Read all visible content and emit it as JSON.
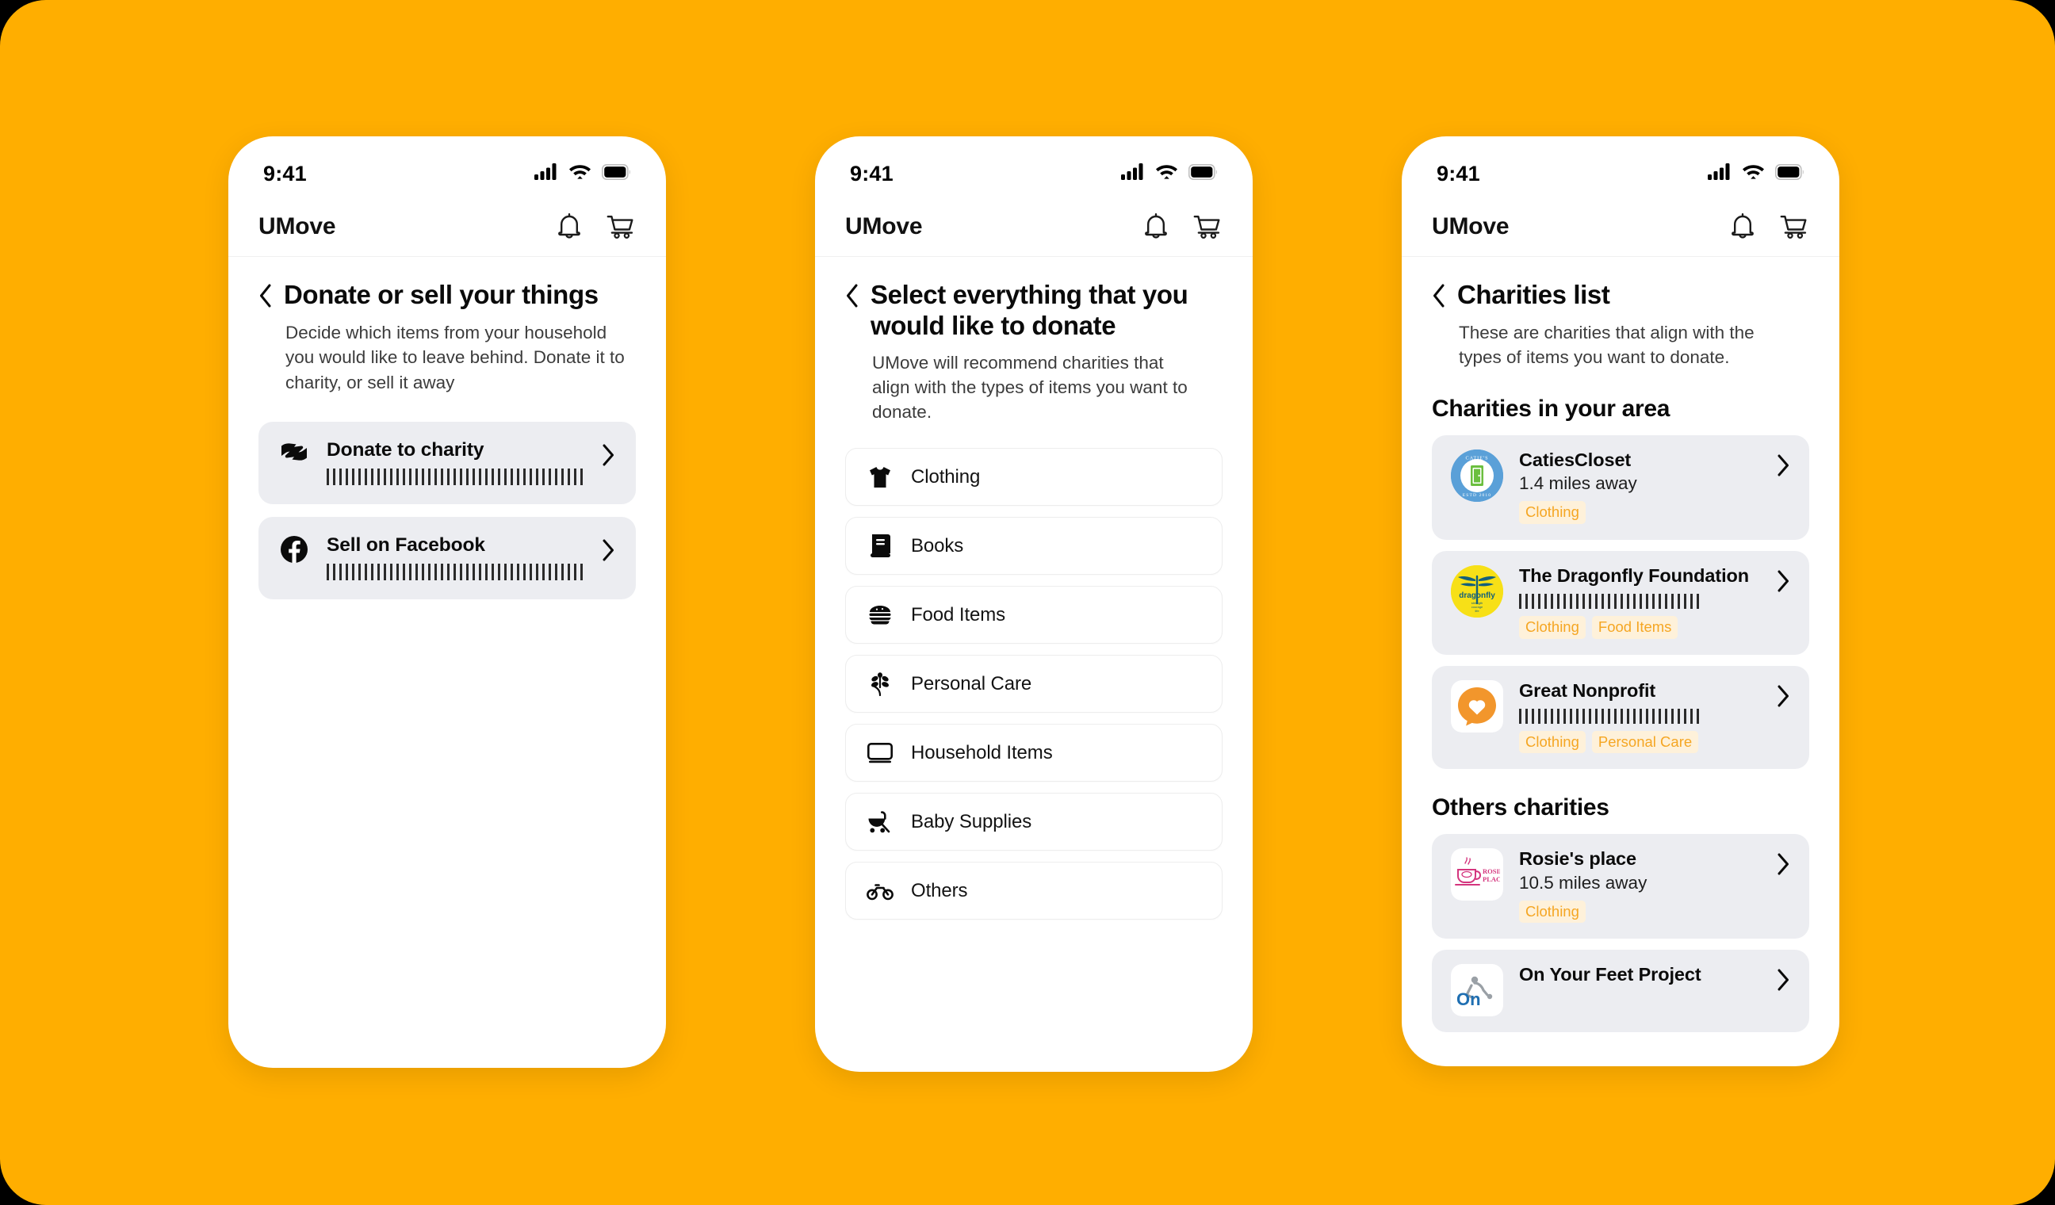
{
  "background": {
    "color": "#FFAE00"
  },
  "statusbar": {
    "time": "9:41",
    "signal_icon": "cellular-signal-icon",
    "wifi_icon": "wifi-icon",
    "battery_icon": "battery-icon"
  },
  "appbar": {
    "brand": "UMove",
    "bell_icon": "notification-bell-icon",
    "cart_icon": "shopping-cart-icon"
  },
  "accent": {
    "tag_text": "#F5A623",
    "tag_bg": "#FEF1DA",
    "card_bg": "#ECEDF1"
  },
  "screen1": {
    "back_icon": "back-chevron-icon",
    "title": "Donate or sell your things",
    "subtitle": "Decide which items from your household you would like to leave behind. Donate it to charity, or sell it away",
    "options": [
      {
        "label": "Donate to charity",
        "icon": "donation-hands-icon",
        "subtitle_redacted": true,
        "chevron_icon": "chevron-right-icon"
      },
      {
        "label": "Sell on Facebook",
        "icon": "facebook-icon",
        "subtitle_redacted": true,
        "chevron_icon": "chevron-right-icon"
      }
    ]
  },
  "screen2": {
    "back_icon": "back-chevron-icon",
    "title": "Select everything that you would like to donate",
    "subtitle": "UMove will recommend charities that align with the types of items you want to donate.",
    "categories": [
      {
        "label": "Clothing",
        "icon": "tshirt-icon"
      },
      {
        "label": "Books",
        "icon": "book-icon"
      },
      {
        "label": "Food Items",
        "icon": "burger-icon"
      },
      {
        "label": "Personal Care",
        "icon": "leaf-sprig-icon"
      },
      {
        "label": "Household Items",
        "icon": "monitor-icon"
      },
      {
        "label": "Baby Supplies",
        "icon": "stroller-icon"
      },
      {
        "label": "Others",
        "icon": "bicycle-icon"
      }
    ]
  },
  "screen3": {
    "back_icon": "back-chevron-icon",
    "title": "Charities list",
    "subtitle": "These are charities that align with the types of items you want to donate.",
    "sections": [
      {
        "heading": "Charities in your area",
        "charities": [
          {
            "name": "CatiesCloset",
            "distance": "1.4 miles away",
            "redacted": false,
            "tags": [
              "Clothing"
            ],
            "logo": "caties-closet-logo",
            "chevron_icon": "chevron-right-icon"
          },
          {
            "name": "The Dragonfly Foundation",
            "distance": "",
            "redacted": true,
            "tags": [
              "Clothing",
              "Food Items"
            ],
            "logo": "dragonfly-foundation-logo",
            "chevron_icon": "chevron-right-icon"
          },
          {
            "name": "Great Nonprofit",
            "distance": "",
            "redacted": true,
            "tags": [
              "Clothing",
              "Personal Care"
            ],
            "logo": "great-nonprofit-logo",
            "chevron_icon": "chevron-right-icon"
          }
        ]
      },
      {
        "heading": "Others charities",
        "charities": [
          {
            "name": "Rosie's place",
            "distance": "10.5 miles away",
            "redacted": false,
            "tags": [
              "Clothing"
            ],
            "logo": "rosies-place-logo",
            "chevron_icon": "chevron-right-icon"
          },
          {
            "name": "On Your Feet Project",
            "distance": "",
            "redacted": false,
            "tags": [],
            "logo": "on-your-feet-project-logo",
            "chevron_icon": "chevron-right-icon"
          }
        ]
      }
    ]
  }
}
